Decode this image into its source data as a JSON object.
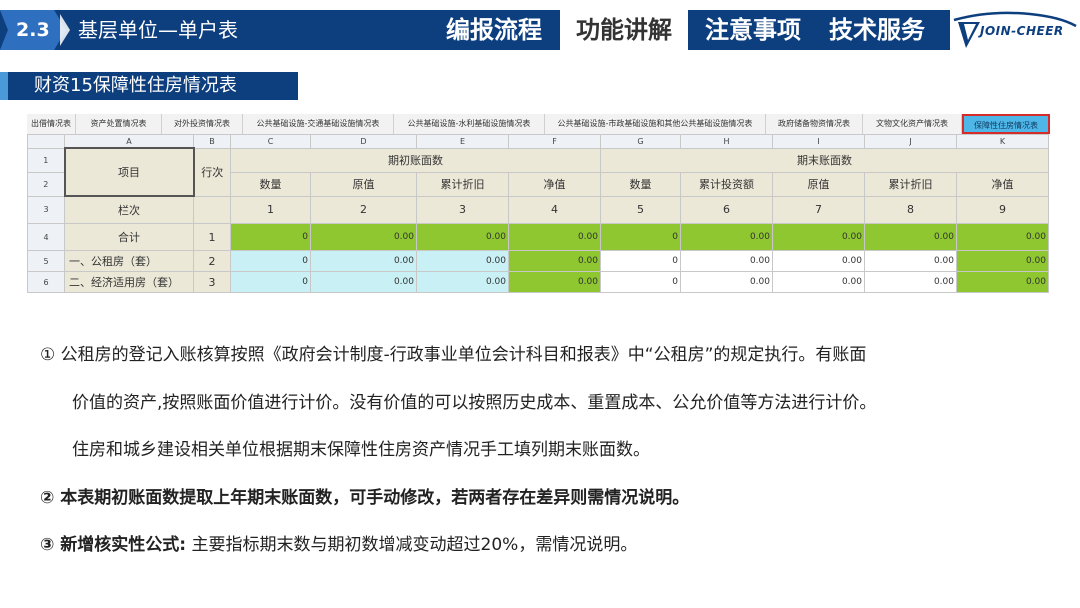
{
  "header": {
    "section_number": "2.3",
    "section_title": "基层单位—单户表",
    "tabs": [
      {
        "label": "编报流程",
        "active": false
      },
      {
        "label": "功能讲解",
        "active": true
      },
      {
        "label": "注意事项",
        "active": false
      },
      {
        "label": "技术服务",
        "active": false
      }
    ],
    "logo_text": "JOIN-CHEER"
  },
  "subtitle": "财资15保障性住房情况表",
  "sheet_tabs": [
    {
      "label": "出借情况表",
      "active": false
    },
    {
      "label": "资产处置情况表",
      "active": false
    },
    {
      "label": "对外投资情况表",
      "active": false
    },
    {
      "label": "公共基础设施-交通基础设施情况表",
      "active": false
    },
    {
      "label": "公共基础设施-水利基础设施情况表",
      "active": false
    },
    {
      "label": "公共基础设施-市政基础设施和其他公共基础设施情况表",
      "active": false
    },
    {
      "label": "政府储备物资情况表",
      "active": false
    },
    {
      "label": "文物文化资产情况表",
      "active": false
    },
    {
      "label": "保障性住房情况表",
      "active": true
    }
  ],
  "grid": {
    "col_letters": [
      "A",
      "B",
      "C",
      "D",
      "E",
      "F",
      "G",
      "H",
      "I",
      "J",
      "K"
    ],
    "row_numbers": [
      "1",
      "2",
      "3",
      "4",
      "5",
      "6"
    ],
    "item_header": "项目",
    "line_header": "行次",
    "opening_group": "期初账面数",
    "closing_group": "期末账面数",
    "opening_cols": [
      "数量",
      "原值",
      "累计折旧",
      "净值"
    ],
    "closing_cols": [
      "数量",
      "累计投资额",
      "原值",
      "累计折旧",
      "净值"
    ],
    "col_index_label": "栏次",
    "col_index": [
      "1",
      "2",
      "3",
      "4",
      "5",
      "6",
      "7",
      "8",
      "9"
    ],
    "rows": [
      {
        "label": "合计",
        "line": "1",
        "values": [
          "0",
          "0.00",
          "0.00",
          "0.00",
          "0",
          "0.00",
          "0.00",
          "0.00",
          "0.00"
        ]
      },
      {
        "label": "一、公租房（套）",
        "line": "2",
        "values": [
          "0",
          "0.00",
          "0.00",
          "0.00",
          "0",
          "0.00",
          "0.00",
          "0.00",
          "0.00"
        ]
      },
      {
        "label": "二、经济适用房（套）",
        "line": "3",
        "values": [
          "0",
          "0.00",
          "0.00",
          "0.00",
          "0",
          "0.00",
          "0.00",
          "0.00",
          "0.00"
        ]
      }
    ]
  },
  "notes": {
    "n1_line1": "① 公租房的登记入账核算按照《政府会计制度-行政事业单位会计科目和报表》中“公租房”的规定执行。有账面",
    "n1_line2": "价值的资产,按照账面价值进行计价。没有价值的可以按照历史成本、重置成本、公允价值等方法进行计价。",
    "n1_line3": "住房和城乡建设相关单位根据期末保障性住房资产情况手工填列期末账面数。",
    "n2": "②  本表期初账面数提取上年期末账面数，可手动修改，若两者存在差异则需情况说明。",
    "n3_lead": "③  新增核实性公式:",
    "n3_rest": " 主要指标期末数与期初数增减变动超过20%，需情况说明。"
  },
  "colors": {
    "header_bg": "#0d3f7f",
    "green_cell": "#8ec72f",
    "blue_cell": "#c9f0f5",
    "active_sheet_tab": "#4fb7e8",
    "active_tab_border": "#d62b2b"
  }
}
